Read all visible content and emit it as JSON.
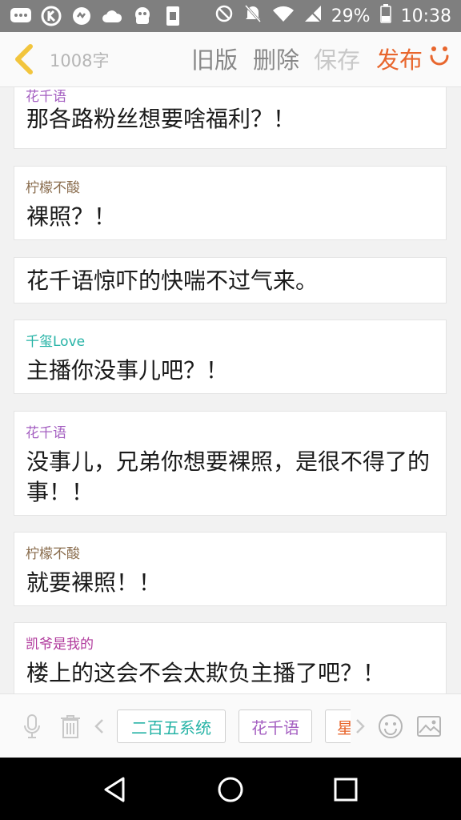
{
  "status": {
    "battery_pct": "29%",
    "time": "10:38"
  },
  "header": {
    "word_count": "1008字",
    "old_version_label": "旧版",
    "delete_label": "删除",
    "save_label": "保存",
    "publish_label": "发布"
  },
  "colors": {
    "publish": "#e8662d",
    "nick_purple": "#a45fc1",
    "nick_brown": "#8a6d4e",
    "nick_teal": "#26b3a6",
    "nick_magenta": "#b0399c"
  },
  "messages": [
    {
      "nick": "花千语",
      "text": "那各路粉丝想要啥福利？！"
    },
    {
      "nick": "柠檬不酸",
      "text": "裸照？！"
    },
    {
      "nick": "",
      "text": "花千语惊吓的快喘不过气来。"
    },
    {
      "nick": "千玺Love",
      "text": "主播你没事儿吧？！"
    },
    {
      "nick": "花千语",
      "text": "没事儿，兄弟你想要裸照，是很不得了的事！！"
    },
    {
      "nick": "柠檬不酸",
      "text": "就要裸照！！"
    },
    {
      "nick": "凯爷是我的",
      "text": "楼上的这会不会太欺负主播了吧？！"
    }
  ],
  "toolbar": {
    "chips": [
      "二百五系统",
      "花千语",
      "星"
    ],
    "icons": [
      "microphone-icon",
      "trash-icon",
      "chevron-left-icon",
      "chevron-right-icon",
      "emoji-icon",
      "image-icon"
    ]
  }
}
